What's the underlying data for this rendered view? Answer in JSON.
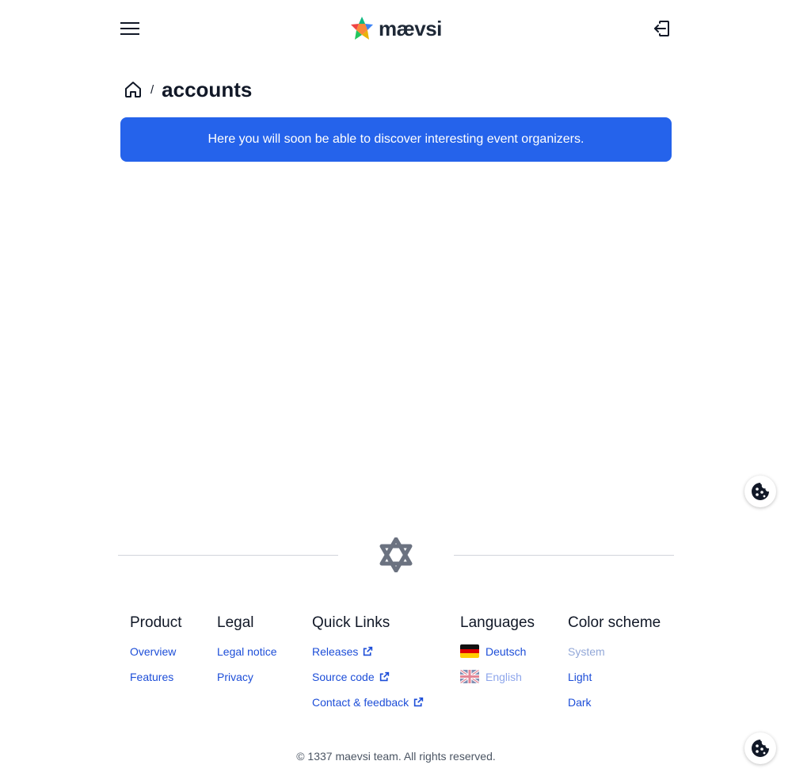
{
  "header": {
    "brand": "mævsi",
    "menu_icon": "hamburger-menu-icon",
    "signin_icon": "sign-in-icon"
  },
  "breadcrumb": {
    "home_icon": "home-icon",
    "separator": "/",
    "current": "accounts"
  },
  "banner": {
    "text": "Here you will soon be able to discover interesting event organizers.",
    "color": "#2563eb"
  },
  "footer": {
    "product": {
      "title": "Product",
      "items": [
        "Overview",
        "Features"
      ]
    },
    "legal": {
      "title": "Legal",
      "items": [
        "Legal notice",
        "Privacy"
      ]
    },
    "quick_links": {
      "title": "Quick Links",
      "items": [
        "Releases",
        "Source code",
        "Contact & feedback"
      ]
    },
    "languages": {
      "title": "Languages",
      "items": [
        "Deutsch",
        "English"
      ],
      "selected": "English"
    },
    "color_scheme": {
      "title": "Color scheme",
      "items": [
        "System",
        "Light",
        "Dark"
      ],
      "selected": "System"
    },
    "copyright": "© 1337 maevsi team. All rights reserved."
  },
  "colors": {
    "link": "#1d4ed8",
    "muted_link": "#93a8d8"
  }
}
